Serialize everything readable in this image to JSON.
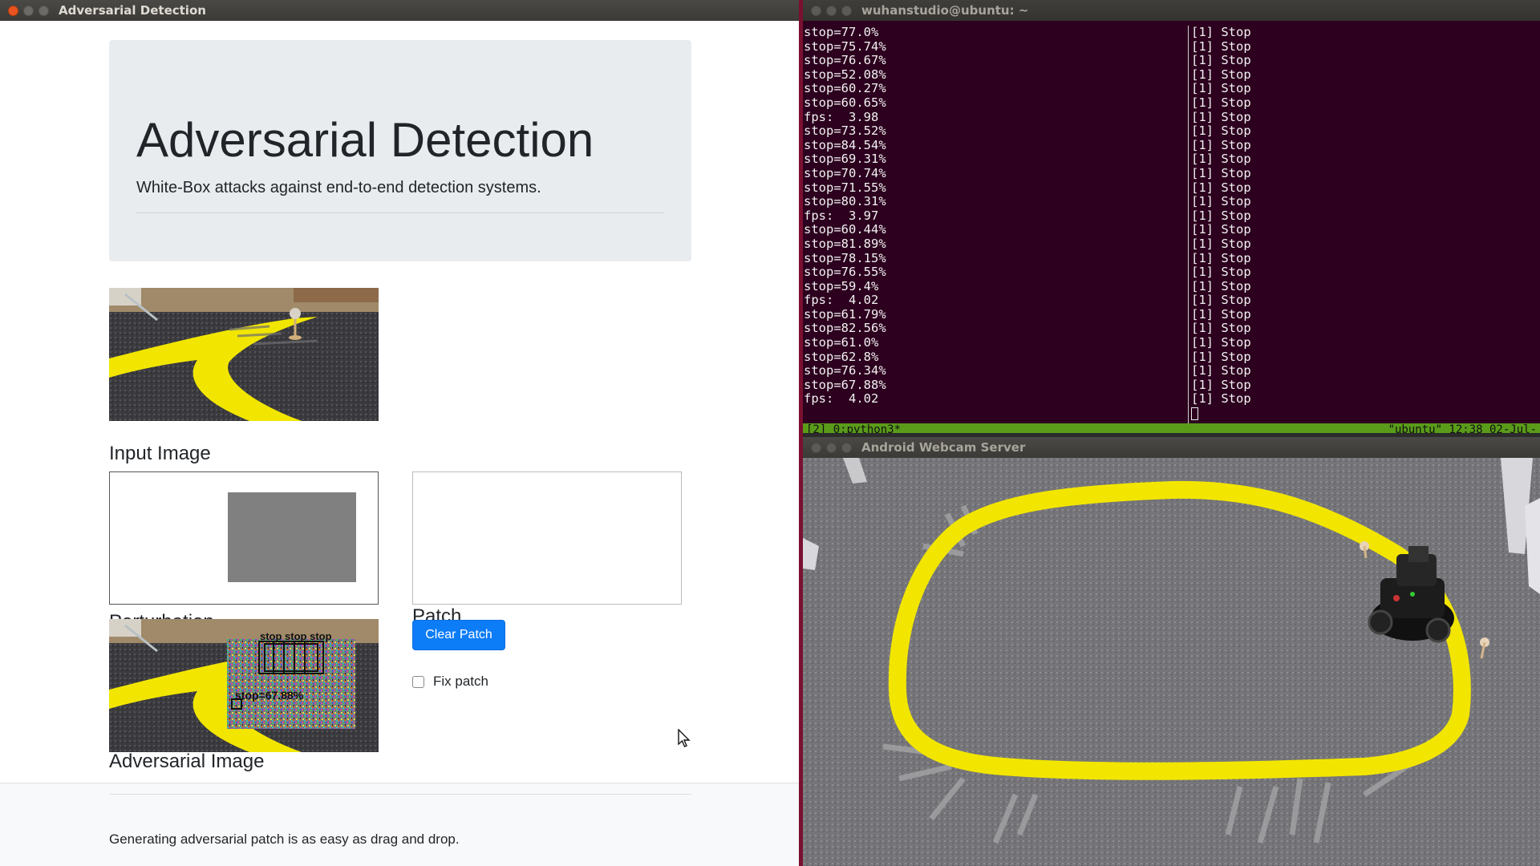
{
  "browser": {
    "window_title": "Adversarial Detection",
    "jumbotron": {
      "title": "Adversarial Detection",
      "subtitle": "White-Box attacks against end-to-end detection systems."
    },
    "input_image_label": "Input Image",
    "perturbation_label": "Perturbation",
    "patch_label": "Patch",
    "adversarial_image_label": "Adversarial Image",
    "clear_patch_label": "Clear Patch",
    "fix_patch_label": "Fix patch",
    "fix_patch_checked": false,
    "adversarial_overlay_text": "stop=67.88%",
    "footer_text": "Generating adversarial patch is as easy as drag and drop."
  },
  "terminal": {
    "window_title": "wuhanstudio@ubuntu: ~",
    "left_lines": [
      "stop=77.0%",
      "stop=75.74%",
      "stop=76.67%",
      "stop=52.08%",
      "stop=60.27%",
      "stop=60.65%",
      "fps:  3.98",
      "stop=73.52%",
      "stop=84.54%",
      "stop=69.31%",
      "stop=70.74%",
      "stop=71.55%",
      "stop=80.31%",
      "fps:  3.97",
      "stop=60.44%",
      "stop=81.89%",
      "stop=78.15%",
      "stop=76.55%",
      "stop=59.4%",
      "fps:  4.02",
      "stop=61.79%",
      "stop=82.56%",
      "stop=61.0%",
      "stop=62.8%",
      "stop=76.34%",
      "stop=67.88%",
      "fps:  4.02"
    ],
    "right_lines": [
      "[1] Stop",
      "[1] Stop",
      "[1] Stop",
      "[1] Stop",
      "[1] Stop",
      "[1] Stop",
      "[1] Stop",
      "[1] Stop",
      "[1] Stop",
      "[1] Stop",
      "[1] Stop",
      "[1] Stop",
      "[1] Stop",
      "[1] Stop",
      "[1] Stop",
      "[1] Stop",
      "[1] Stop",
      "[1] Stop",
      "[1] Stop",
      "[1] Stop",
      "[1] Stop",
      "[1] Stop",
      "[1] Stop",
      "[1] Stop",
      "[1] Stop",
      "[1] Stop",
      "[1] Stop"
    ],
    "status_left": "[2] 0:python3*",
    "status_right": "\"ubuntu\" 12:38 02-Jul-"
  },
  "webcam": {
    "window_title": "Android Webcam Server"
  },
  "colors": {
    "primary_button": "#0d7cf7",
    "terminal_bg": "#2c001e",
    "tmux_status": "#5a9c1a",
    "track_yellow": "#f2e600",
    "jumbotron_bg": "#e9ecef"
  },
  "icons": [
    "close-icon",
    "minimize-icon",
    "maximize-icon",
    "mouse-pointer-icon"
  ]
}
